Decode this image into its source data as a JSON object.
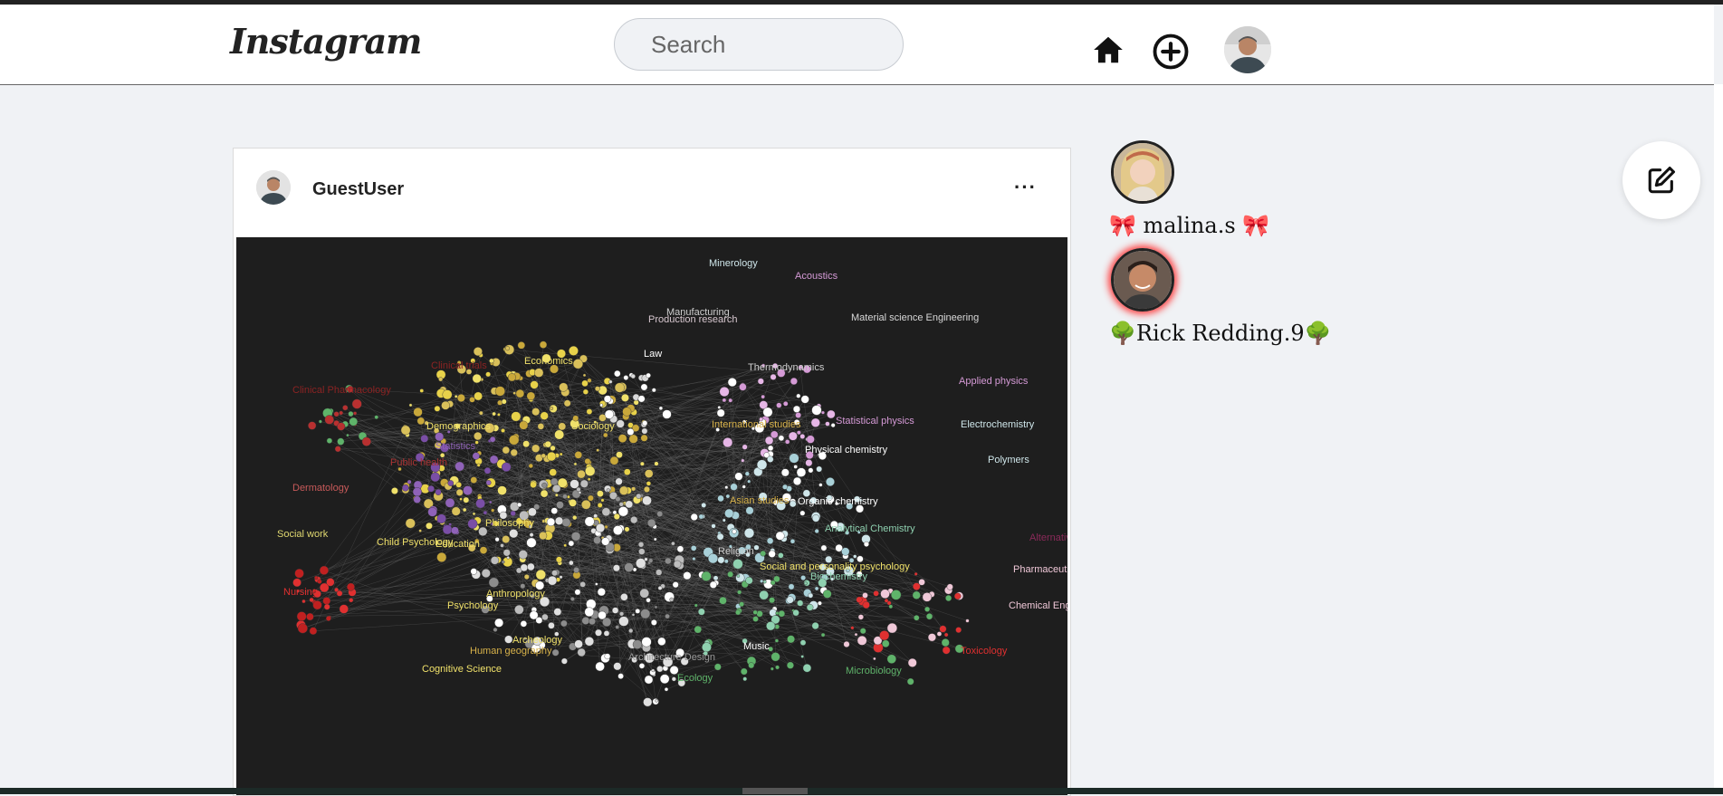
{
  "header": {
    "logo": "Instagram",
    "search_placeholder": "Search",
    "icons": [
      "home-icon",
      "add-circle-icon",
      "profile-avatar"
    ]
  },
  "post": {
    "username": "GuestUser",
    "more": "···",
    "image_labels": {
      "Minerology": "#cfe6ea",
      "Acoustics": "#d59ad6",
      "Manufacturing": "#cfcfcf",
      "Production research": "#d8c8d0",
      "Law": "#ffffff",
      "Material science Engineering": "#d8d8d8",
      "Thermodynamics": "#cfcfcf",
      "Economics": "#f0e16a",
      "Clinical trials": "#8b2323",
      "Clinical Pharmacology": "#8b2323",
      "Demographics": "#f0e16a",
      "Sociology": "#f0e16a",
      "Statistics": "#8f62b8",
      "International studies": "#d8b24a",
      "Applied physics": "#d59ad6",
      "Statistical physics": "#d59ad6",
      "Electrochemistry": "#cfe6ea",
      "Physical chemistry": "#ffffff",
      "Polymers": "#cfe6ea",
      "Public health": "#a83232",
      "Dermatology": "#c85a5a",
      "Asian studies": "#d8b24a",
      "Organic chemistry": "#ffffff",
      "Philosophy": "#f0e16a",
      "Social work": "#e0d870",
      "Child Psychology": "#f0e16a",
      "Education": "#f0e16a",
      "Religion": "#cfcfcf",
      "Analytical Chemistry": "#8fd1b0",
      "Alternative energy": "#8b2a5a",
      "Social and personality psychology": "#f0e16a",
      "Biochemistry": "#8fd1b0",
      "Pharmaceutical research": "#f0c8d8",
      "Nursing": "#e03030",
      "Anthropology": "#f0e16a",
      "Psychology": "#f0e16a",
      "Chemical Engineering": "#f0c8d8",
      "Archeology": "#f0e16a",
      "Human geography": "#d8b24a",
      "Music": "#ffffff",
      "Toxicology": "#e03030",
      "Cognitive Science": "#f0e16a",
      "Architecture Design": "#9a9a9a",
      "Ecology": "#5fb36a",
      "Microbiology": "#5fb36a"
    }
  },
  "stories": [
    {
      "name": "🎀 malina.s 🎀"
    },
    {
      "name": "🌳Rick Redding.9🌳"
    }
  ]
}
